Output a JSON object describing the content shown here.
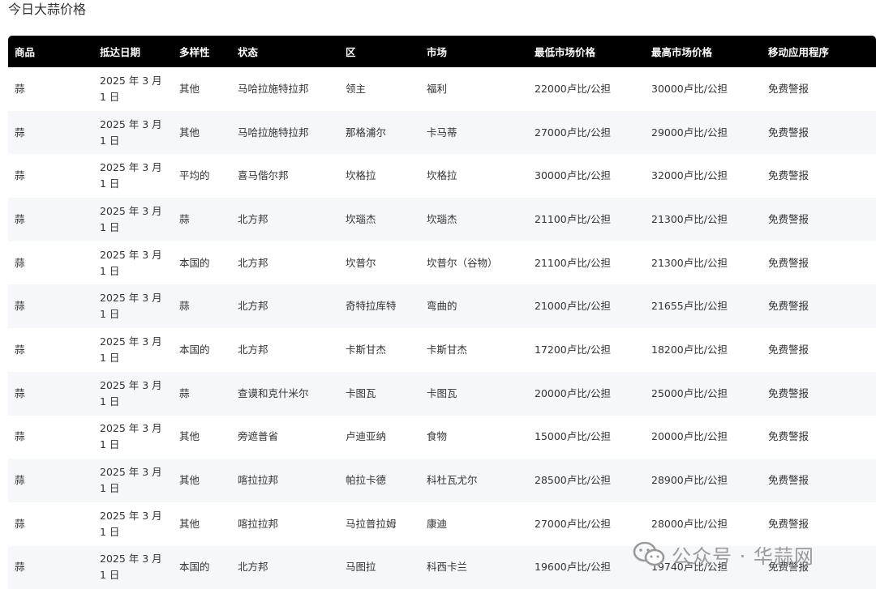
{
  "page": {
    "title": "今日大蒜价格"
  },
  "table": {
    "headers": [
      "商品",
      "抵达日期",
      "多样性",
      "状态",
      "区",
      "市场",
      "最低市场价格",
      "最高市场价格",
      "移动应用程序"
    ],
    "rows": [
      {
        "commodity": "蒜",
        "date": "2025 年 3 月 1 日",
        "variety": "其他",
        "state": "马哈拉施特拉邦",
        "district": "领主",
        "market": "福利",
        "min_price": "22000卢比/公担",
        "max_price": "30000卢比/公担",
        "app": "免费警报"
      },
      {
        "commodity": "蒜",
        "date": "2025 年 3 月 1 日",
        "variety": "其他",
        "state": "马哈拉施特拉邦",
        "district": "那格浦尔",
        "market": "卡马蒂",
        "min_price": "27000卢比/公担",
        "max_price": "29000卢比/公担",
        "app": "免费警报"
      },
      {
        "commodity": "蒜",
        "date": "2025 年 3 月 1 日",
        "variety": "平均的",
        "state": "喜马偕尔邦",
        "district": "坎格拉",
        "market": "坎格拉",
        "min_price": "30000卢比/公担",
        "max_price": "32000卢比/公担",
        "app": "免费警报"
      },
      {
        "commodity": "蒜",
        "date": "2025 年 3 月 1 日",
        "variety": "蒜",
        "state": "北方邦",
        "district": "坎瑙杰",
        "market": "坎瑙杰",
        "min_price": "21100卢比/公担",
        "max_price": "21300卢比/公担",
        "app": "免费警报"
      },
      {
        "commodity": "蒜",
        "date": "2025 年 3 月 1 日",
        "variety": "本国的",
        "state": "北方邦",
        "district": "坎普尔",
        "market": "坎普尔（谷物）",
        "min_price": "21100卢比/公担",
        "max_price": "21300卢比/公担",
        "app": "免费警报"
      },
      {
        "commodity": "蒜",
        "date": "2025 年 3 月 1 日",
        "variety": "蒜",
        "state": "北方邦",
        "district": "奇特拉库特",
        "market": "弯曲的",
        "min_price": "21000卢比/公担",
        "max_price": "21655卢比/公担",
        "app": "免费警报"
      },
      {
        "commodity": "蒜",
        "date": "2025 年 3 月 1 日",
        "variety": "本国的",
        "state": "北方邦",
        "district": "卡斯甘杰",
        "market": "卡斯甘杰",
        "min_price": "17200卢比/公担",
        "max_price": "18200卢比/公担",
        "app": "免费警报"
      },
      {
        "commodity": "蒜",
        "date": "2025 年 3 月 1 日",
        "variety": "蒜",
        "state": "查谟和克什米尔",
        "district": "卡图瓦",
        "market": "卡图瓦",
        "min_price": "20000卢比/公担",
        "max_price": "25000卢比/公担",
        "app": "免费警报"
      },
      {
        "commodity": "蒜",
        "date": "2025 年 3 月 1 日",
        "variety": "其他",
        "state": "旁遮普省",
        "district": "卢迪亚纳",
        "market": "食物",
        "min_price": "15000卢比/公担",
        "max_price": "20000卢比/公担",
        "app": "免费警报"
      },
      {
        "commodity": "蒜",
        "date": "2025 年 3 月 1 日",
        "variety": "其他",
        "state": "喀拉拉邦",
        "district": "帕拉卡德",
        "market": "科杜瓦尤尔",
        "min_price": "28500卢比/公担",
        "max_price": "28900卢比/公担",
        "app": "免费警报"
      },
      {
        "commodity": "蒜",
        "date": "2025 年 3 月 1 日",
        "variety": "其他",
        "state": "喀拉拉邦",
        "district": "马拉普拉姆",
        "market": "康迪",
        "min_price": "27000卢比/公担",
        "max_price": "28000卢比/公担",
        "app": "免费警报"
      },
      {
        "commodity": "蒜",
        "date": "2025 年 3 月 1 日",
        "variety": "本国的",
        "state": "北方邦",
        "district": "马图拉",
        "market": "科西卡兰",
        "min_price": "19600卢比/公担",
        "max_price": "19740卢比/公担",
        "app": "免费警报"
      }
    ]
  },
  "watermark": {
    "text": "公众号 · 华蒜网",
    "icon": "wechat-icon"
  },
  "colors": {
    "header_bg": "#000000",
    "link": "#2a6ad8",
    "stripe": "#f5f7fa"
  }
}
